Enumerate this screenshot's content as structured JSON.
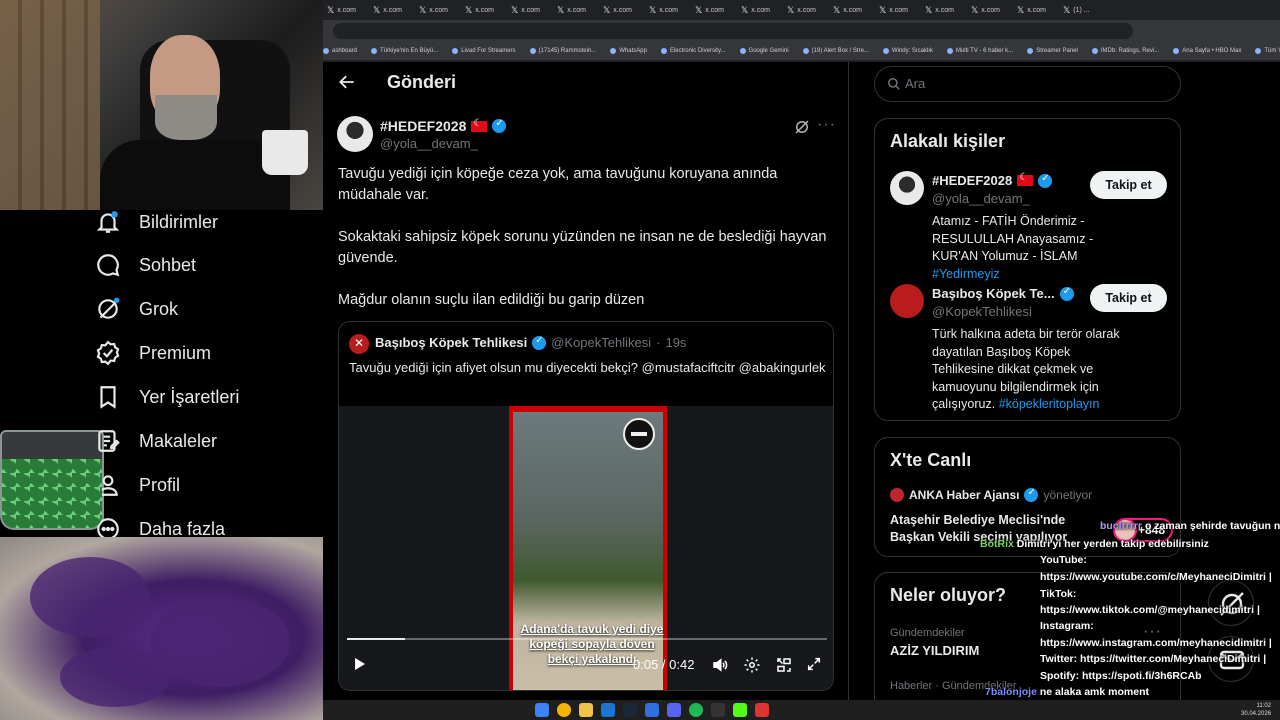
{
  "browser": {
    "tab_label": "x.com",
    "tab_count": 17,
    "tab_notify_label": "(1) ...",
    "bookmarks": [
      "ashboard",
      "Türkiye'nin En Büyü...",
      "Livad For Streamers",
      "(17145) Rammstein...",
      "WhatsApp",
      "Electronic Diversity...",
      "Google Gemini",
      "(19) Alert Box / Stre...",
      "Windy: Sıcaklık",
      "Multi TV - 6 haber k...",
      "Streamer Panel",
      "IMDb: Ratings, Revi...",
      "Ana Sayfa • HBO Max",
      "Tüm Yer İşaretleri"
    ]
  },
  "nav": {
    "items": [
      {
        "label": "Bildirimler",
        "icon": "bell-icon"
      },
      {
        "label": "Sohbet",
        "icon": "chat-icon"
      },
      {
        "label": "Grok",
        "icon": "grok-icon"
      },
      {
        "label": "Premium",
        "icon": "premium-icon"
      },
      {
        "label": "Yer İşaretleri",
        "icon": "bookmark-icon"
      },
      {
        "label": "Makaleler",
        "icon": "articles-icon"
      },
      {
        "label": "Profil",
        "icon": "profile-icon"
      },
      {
        "label": "Daha fazla",
        "icon": "more-circle-icon"
      }
    ]
  },
  "post": {
    "header_title": "Gönderi",
    "author": {
      "name": "#HEDEF2028",
      "handle": "@yola__devam_"
    },
    "paragraphs": [
      "Tavuğu yediği için köpeğe ceza yok, ama tavuğunu koruyana anında müdahale var.",
      " Sokaktaki sahipsiz köpek sorunu yüzünden ne insan ne de beslediği hayvan güvende.",
      " Mağdur olanın suçlu ilan edildiği bu garip düzen"
    ],
    "quote": {
      "name": "Başıboş Köpek Tehlikesi",
      "handle": "@KopekTehlikesi",
      "separator": "·",
      "time": "19s",
      "text": "Tavuğu yediği için afiyet olsun mu diyecekti bekçi? @mustafaciftcitr @abakingurlek",
      "video": {
        "caption": "Adana'da tavuk yedi diye köpeği sopayla döven bekçi yakalandı",
        "current_time": "0:05",
        "total_time": "0:42",
        "time_display": "0:05 / 0:42",
        "progress": 0.12
      }
    }
  },
  "search": {
    "placeholder": "Ara"
  },
  "related": {
    "title": "Alakalı kişiler",
    "people": [
      {
        "name": "#HEDEF2028",
        "handle": "@yola__devam_",
        "bio": "Atamız - FATİH Önderimiz - RESULULLAH Anayasamız - KUR'AN Yolumuz - İSLAM ",
        "bio_tag": "#Yedirmeyiz",
        "follow_label": "Takip et"
      },
      {
        "name": "Başıboş Köpek Te...",
        "handle": "@KopekTehlikesi",
        "bio": "Türk halkına adeta bir terör olarak dayatılan Başıboş Köpek Tehlikesine dikkat çekmek ve kamuoyunu bilgilendirmek için çalışıyoruz. ",
        "bio_tag": "#köpekleritoplayın",
        "follow_label": "Takip et"
      }
    ]
  },
  "live": {
    "title": "X'te Canlı",
    "host": "ANKA Haber Ajansı",
    "role": "yönetiyor",
    "space_title": "Ataşehir Belediye Meclisi'nde Başkan Vekili seçimi yapılıyor",
    "listener_count": "+848"
  },
  "trends": {
    "title": "Neler oluyor?",
    "items": [
      {
        "category": "Gündemdekiler",
        "name": "AZİZ YILDIRIM"
      },
      {
        "category": "Haberler · Gündemdekiler",
        "name": ""
      }
    ]
  },
  "chat": {
    "lines": [
      {
        "user": "bucirrrrr",
        "text": "o zaman şehirde tavuğun ne işi var"
      },
      {
        "user": "BotRix",
        "text": "Dimitri'yi her yerden takip edebilirsiniz"
      },
      {
        "user": "",
        "text": "YouTube:"
      },
      {
        "user": "",
        "text": "https://www.youtube.com/c/MeyhaneciDimitri |"
      },
      {
        "user": "",
        "text": "TikTok:"
      },
      {
        "user": "",
        "text": "https://www.tiktok.com/@meyhanecidimitri |"
      },
      {
        "user": "",
        "text": "Instagram:"
      },
      {
        "user": "",
        "text": "https://www.instagram.com/meyhanecidimitri |"
      },
      {
        "user": "",
        "text": "Twitter: https://twitter.com/MeyhaneciDimitri |"
      },
      {
        "user": "",
        "text": "Spotify: https://spoti.fi/3h6RCAb"
      },
      {
        "user": "7balonjoje",
        "text": "ne alaka amk moment"
      }
    ]
  },
  "taskbar": {
    "time": "11:02",
    "date": "30.04.2026"
  },
  "colors": {
    "accent": "#1d9bf0",
    "live": "#f91880",
    "background": "#000000",
    "text": "#e7e9ea",
    "muted": "#71767b"
  }
}
